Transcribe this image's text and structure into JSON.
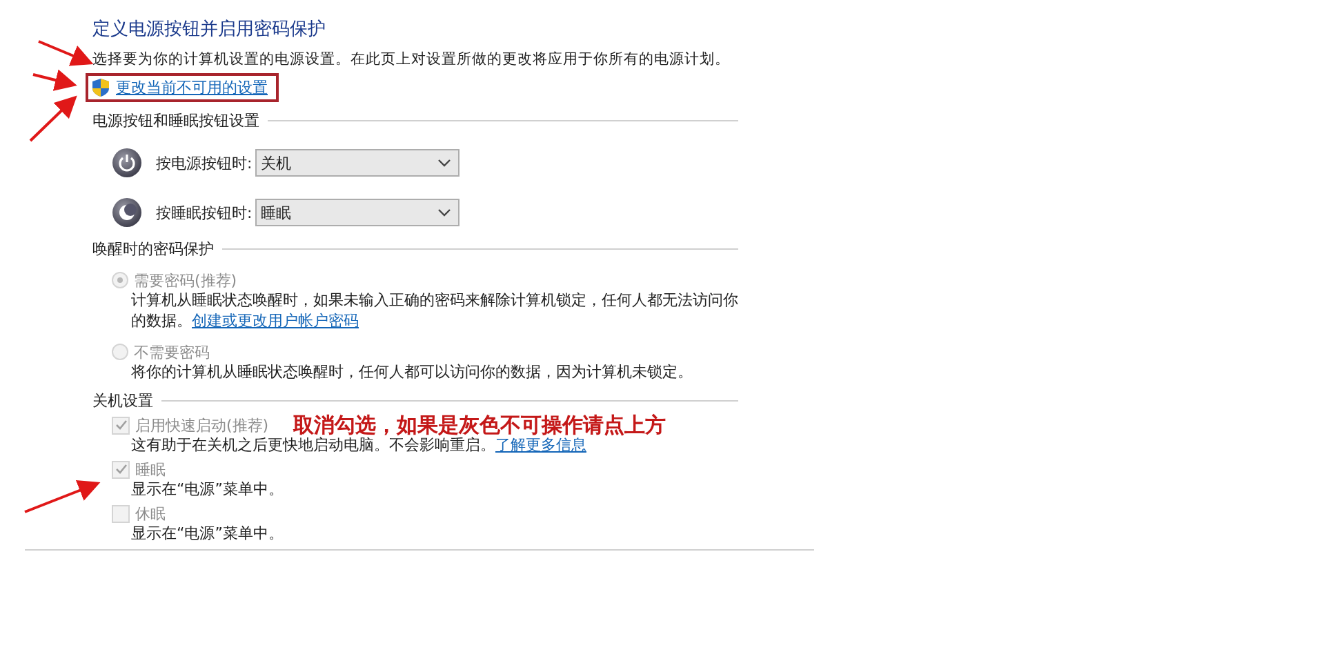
{
  "title": "定义电源按钮并启用密码保护",
  "description": "选择要为你的计算机设置的电源设置。在此页上对设置所做的更改将应用于你所有的电源计划。",
  "admin_link": {
    "text": "更改当前不可用的设置",
    "highlighted": true
  },
  "power_section": {
    "heading": "电源按钮和睡眠按钮设置",
    "rows": [
      {
        "kind": "power",
        "label": "按电源按钮时:",
        "value": "关机"
      },
      {
        "kind": "sleep",
        "label": "按睡眠按钮时:",
        "value": "睡眠"
      }
    ]
  },
  "password_section": {
    "heading": "唤醒时的密码保护",
    "options": [
      {
        "label": "需要密码(推荐)",
        "selected": true,
        "disabled": true,
        "description": "计算机从睡眠状态唤醒时，如果未输入正确的密码来解除计算机锁定，任何人都无法访问你的数据。",
        "link": "创建或更改用户帐户密码"
      },
      {
        "label": "不需要密码",
        "selected": false,
        "disabled": true,
        "description": "将你的计算机从睡眠状态唤醒时，任何人都可以访问你的数据，因为计算机未锁定。"
      }
    ]
  },
  "shutdown_section": {
    "heading": "关机设置",
    "options": [
      {
        "label": "启用快速启动(推荐)",
        "checked": true,
        "disabled": true,
        "description": "这有助于在关机之后更快地启动电脑。不会影响重启。",
        "link": "了解更多信息"
      },
      {
        "label": "睡眠",
        "checked": true,
        "disabled": true,
        "description": "显示在“电源”菜单中。"
      },
      {
        "label": "休眠",
        "checked": false,
        "disabled": true,
        "description": "显示在“电源”菜单中。"
      }
    ]
  },
  "annotation": "取消勾选，如果是灰色不可操作请点上方"
}
